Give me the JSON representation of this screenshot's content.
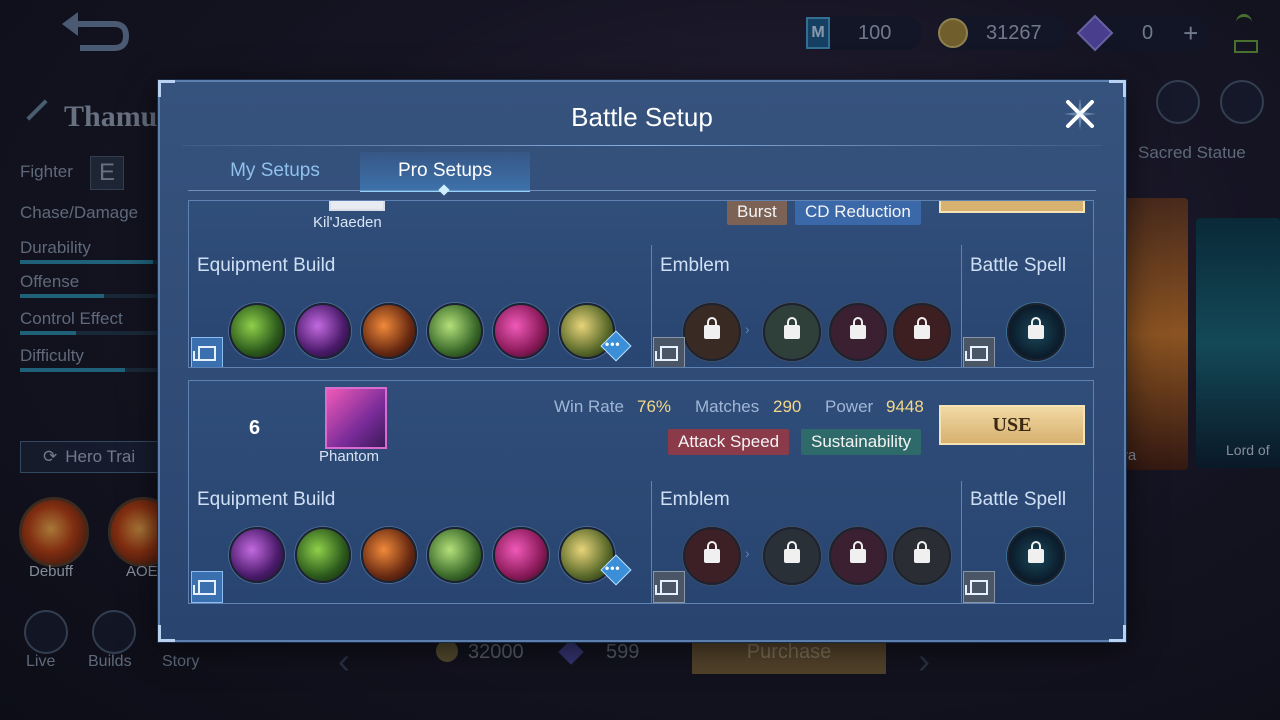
{
  "background": {
    "currencies": {
      "ticket": "100",
      "battle_points": "31267",
      "diamonds": "0"
    },
    "hero_name": "Thamu",
    "role": "Fighter",
    "specialty": "Chase/Damage",
    "stats": [
      {
        "label": "Durability",
        "level": 0.95
      },
      {
        "label": "Offense",
        "level": 0.6
      },
      {
        "label": "Control Effect",
        "level": 0.4
      },
      {
        "label": "Difficulty",
        "level": 0.75
      }
    ],
    "hero_trial": "Hero Trai",
    "skills": [
      "Debuff",
      "AOE"
    ],
    "bottom_links": [
      "Live",
      "Builds",
      "Story"
    ],
    "sacred_statue": "Sacred Statue",
    "skin_labels": [
      "ava",
      "Lord of"
    ],
    "price_bp": "32000",
    "price_diamond": "599",
    "purchase": "Purchase"
  },
  "modal": {
    "title": "Battle Setup",
    "tabs": {
      "my": "My Setups",
      "pro": "Pro Setups"
    },
    "labels": {
      "equipment": "Equipment Build",
      "emblem": "Emblem",
      "spell": "Battle Spell"
    },
    "setups": [
      {
        "player": "Kil'Jaeden",
        "tags": [
          "Burst",
          "CD Reduction"
        ],
        "items": [
          "hunter-strike",
          "magic-boots",
          "blade-of-despair",
          "dominance-ice",
          "malefic-roar",
          "athenas-shield"
        ],
        "emblem_colors": [
          "#3a2a24",
          "#2f3f3a",
          "#3a2030",
          "#3d1f22"
        ],
        "spell": "retribution"
      },
      {
        "rank": "6",
        "player": "Phantom",
        "win_rate_label": "Win Rate",
        "win_rate": "76%",
        "matches_label": "Matches",
        "matches": "290",
        "power_label": "Power",
        "power": "9448",
        "tags": [
          "Attack Speed",
          "Sustainability"
        ],
        "use": "USE",
        "items": [
          "magic-boots",
          "hunter-strike",
          "blade-of-despair",
          "dominance-ice",
          "malefic-roar",
          "athenas-shield"
        ],
        "emblem_colors": [
          "#3d1f26",
          "#2a3038",
          "#3a2030",
          "#2a2e34"
        ],
        "spell": "retribution"
      }
    ]
  },
  "colors": {
    "tag_burst": "#7c6255",
    "tag_cd": "#3b68a8",
    "tag_attack_speed": "#8b3a4a",
    "tag_sustain": "#2e6a6a",
    "use_gold": "#e3c283"
  }
}
